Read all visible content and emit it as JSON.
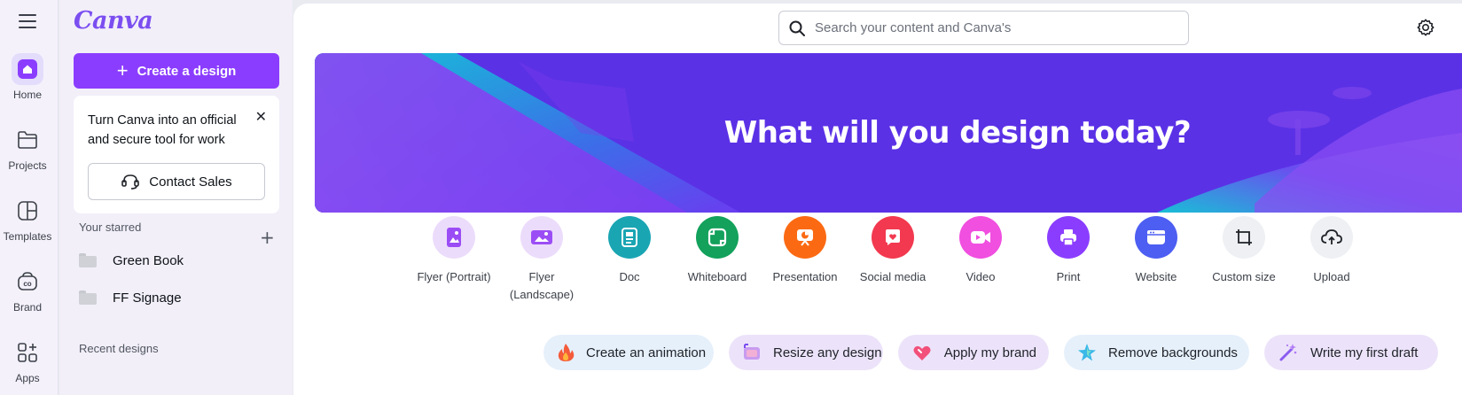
{
  "rail": {
    "items": [
      {
        "label": "Home",
        "icon": "home-icon"
      },
      {
        "label": "Projects",
        "icon": "folder-icon"
      },
      {
        "label": "Templates",
        "icon": "templates-icon"
      },
      {
        "label": "Brand",
        "icon": "brand-icon"
      },
      {
        "label": "Apps",
        "icon": "apps-icon"
      }
    ]
  },
  "panel": {
    "logo": "Canva",
    "create_label": "Create a design",
    "promo_text": "Turn Canva into an official and secure tool for work",
    "contact_label": "Contact Sales",
    "starred_title": "Your starred",
    "starred": [
      {
        "label": "Green Book"
      },
      {
        "label": "FF Signage"
      }
    ],
    "recent_title": "Recent designs"
  },
  "search": {
    "placeholder": "Search your content and Canva's"
  },
  "hero": {
    "title": "What will you design today?"
  },
  "design_types": [
    {
      "label": "Flyer (Portrait)",
      "color": "#e7d3fb"
    },
    {
      "label": "Flyer (Landscape)",
      "color": "#e7d3fb"
    },
    {
      "label": "Doc",
      "color": "#1aa5b3"
    },
    {
      "label": "Whiteboard",
      "color": "#13a15b"
    },
    {
      "label": "Presentation",
      "color": "#fb6a13"
    },
    {
      "label": "Social media",
      "color": "#f2394f"
    },
    {
      "label": "Video",
      "color": "#f04fe0"
    },
    {
      "label": "Print",
      "color": "#8b3dff"
    },
    {
      "label": "Website",
      "color": "#4d5ef2"
    },
    {
      "label": "Custom size",
      "color": "#eef0f3"
    },
    {
      "label": "Upload",
      "color": "#eef0f3"
    }
  ],
  "quick_actions": [
    {
      "label": "Create an animation",
      "bg": "#e6f0fb"
    },
    {
      "label": "Resize any design",
      "bg": "#ece3fa"
    },
    {
      "label": "Apply my brand",
      "bg": "#ece3fa"
    },
    {
      "label": "Remove backgrounds",
      "bg": "#e6f0fb"
    },
    {
      "label": "Write my first draft",
      "bg": "#ece3fa"
    }
  ],
  "colors": {
    "accent": "#8b3dff",
    "panel_bg": "#f2eff9"
  }
}
